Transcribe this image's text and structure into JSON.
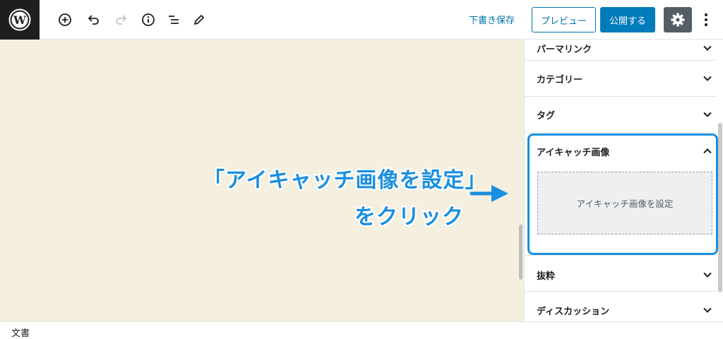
{
  "toolbar": {
    "icons": [
      "wordpress-logo",
      "add-block-icon",
      "undo-icon",
      "redo-icon",
      "info-icon",
      "list-view-icon",
      "edit-icon",
      "gear-icon",
      "more-vertical-icon"
    ],
    "save_draft_label": "下書き保存",
    "preview_label": "プレビュー",
    "publish_label": "公開する"
  },
  "annotation": {
    "line1": "「アイキャッチ画像を設定」",
    "line2": "をクリック",
    "color": "#1a8fe0"
  },
  "sidebar": {
    "panels": [
      {
        "label": "パーマリンク",
        "expanded": false
      },
      {
        "label": "カテゴリー",
        "expanded": false
      },
      {
        "label": "タグ",
        "expanded": false
      },
      {
        "label": "アイキャッチ画像",
        "expanded": true
      },
      {
        "label": "抜粋",
        "expanded": false
      },
      {
        "label": "ディスカッション",
        "expanded": false
      }
    ],
    "featured_image_button": "アイキャッチ画像を設定"
  },
  "footer": {
    "label": "文書"
  },
  "colors": {
    "accent": "#007cba",
    "link": "#0073aa",
    "canvas": "#f5efe0",
    "highlight": "#1a8fe0"
  }
}
